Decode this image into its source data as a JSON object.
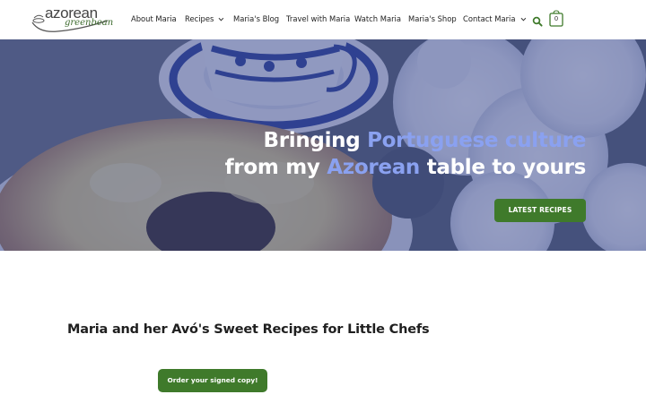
{
  "header": {
    "logo": {
      "word": "azorean",
      "script": "greenbean"
    },
    "nav": [
      {
        "label": "About Maria",
        "has_dropdown": false
      },
      {
        "label": "Recipes",
        "has_dropdown": true
      },
      {
        "label": "Maria's Blog",
        "has_dropdown": false
      },
      {
        "label": "Travel with Maria",
        "has_dropdown": false
      },
      {
        "label": "Watch Maria",
        "has_dropdown": false
      },
      {
        "label": "Maria's Shop",
        "has_dropdown": false
      },
      {
        "label": "Contact Maria",
        "has_dropdown": true
      }
    ],
    "search_icon": "search-icon",
    "cart_icon": "shopping-bag-icon",
    "cart_count": "0"
  },
  "hero": {
    "line1": {
      "prefix": "Bringing ",
      "accent": "Portuguese culture"
    },
    "line2": {
      "prefix": "from my ",
      "accent": "Azorean",
      "suffix": " table to yours"
    },
    "button_label": "LATEST RECIPES"
  },
  "content": {
    "title": "Maria and her Avó's Sweet Recipes for Little Chefs",
    "order_button_label": "Order your signed copy!"
  },
  "colors": {
    "accent_green": "#3f7a2b",
    "hero_tint": "#34448a",
    "hero_accent_text": "#8aa1f0"
  }
}
